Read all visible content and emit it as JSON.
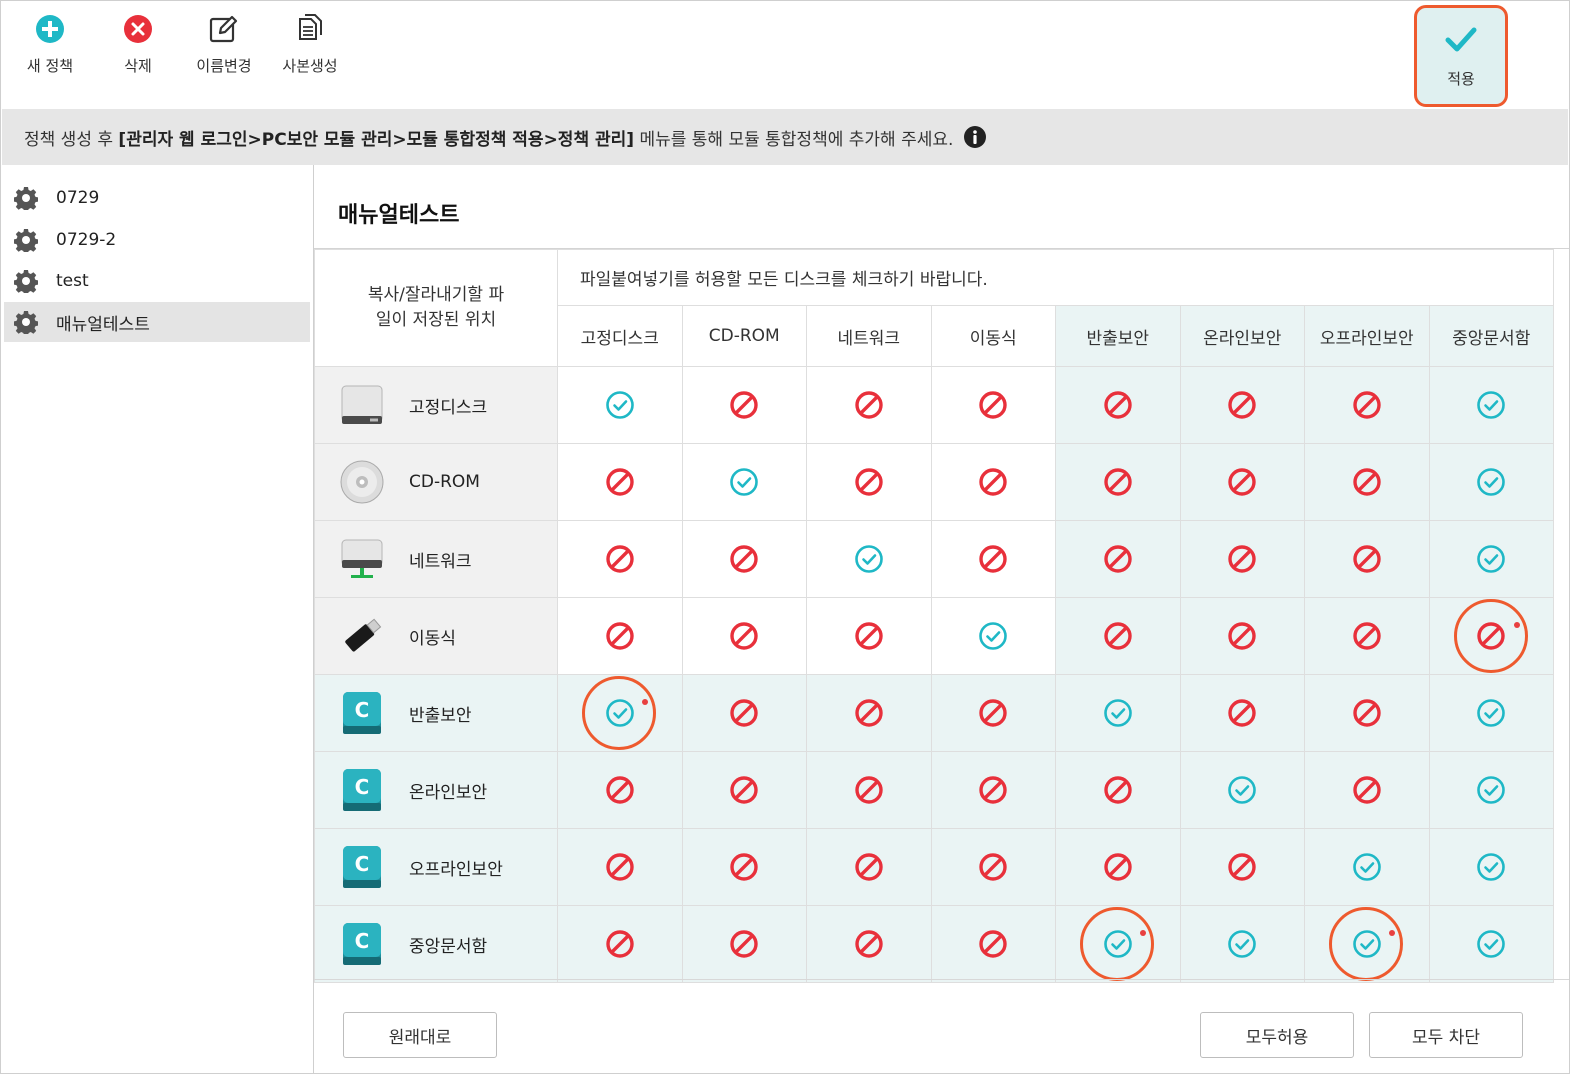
{
  "toolbar": {
    "new_policy": "새 정책",
    "delete": "삭제",
    "rename": "이름변경",
    "copy": "사본생성",
    "apply": "적용"
  },
  "infobar": {
    "prefix": "정책 생성 후 ",
    "path": "[관리자 웹 로그인>PC보안 모듈 관리>모듈 통합정책 적용>정책 관리]",
    "suffix": " 메뉴를 통해 모듈 통합정책에 추가해 주세요."
  },
  "sidebar": {
    "items": [
      {
        "label": "0729"
      },
      {
        "label": "0729-2"
      },
      {
        "label": "test"
      },
      {
        "label": "매뉴얼테스트"
      }
    ]
  },
  "main": {
    "title": "매뉴얼테스트",
    "corner_label_line1": "복사/잘라내기할 파",
    "corner_label_line2": "일이 저장된 위치",
    "instruction": "파일붙여넣기를 허용할 모든 디스크를 체크하기 바랍니다.",
    "columns": [
      "고정디스크",
      "CD-ROM",
      "네트워크",
      "이동식",
      "반출보안",
      "온라인보안",
      "오프라인보안",
      "중앙문서함"
    ],
    "rows": [
      {
        "label": "고정디스크",
        "icon": "hard-disk-icon",
        "values": [
          "allow",
          "block",
          "block",
          "block",
          "block",
          "block",
          "block",
          "allow"
        ]
      },
      {
        "label": "CD-ROM",
        "icon": "cd-rom-icon",
        "values": [
          "block",
          "allow",
          "block",
          "block",
          "block",
          "block",
          "block",
          "allow"
        ]
      },
      {
        "label": "네트워크",
        "icon": "network-drive-icon",
        "values": [
          "block",
          "block",
          "allow",
          "block",
          "block",
          "block",
          "block",
          "allow"
        ]
      },
      {
        "label": "이동식",
        "icon": "usb-drive-icon",
        "values": [
          "block",
          "block",
          "block",
          "allow",
          "block",
          "block",
          "block",
          "block"
        ]
      },
      {
        "label": "반출보안",
        "icon": "secure-drive-icon",
        "values": [
          "allow",
          "block",
          "block",
          "block",
          "allow",
          "block",
          "block",
          "allow"
        ]
      },
      {
        "label": "온라인보안",
        "icon": "secure-drive-icon",
        "values": [
          "block",
          "block",
          "block",
          "block",
          "block",
          "allow",
          "block",
          "allow"
        ]
      },
      {
        "label": "오프라인보안",
        "icon": "secure-drive-icon",
        "values": [
          "block",
          "block",
          "block",
          "block",
          "block",
          "block",
          "allow",
          "allow"
        ]
      },
      {
        "label": "중앙문서함",
        "icon": "secure-drive-icon",
        "values": [
          "block",
          "block",
          "block",
          "block",
          "allow",
          "allow",
          "allow",
          "allow"
        ]
      }
    ],
    "changed_cells": [
      {
        "row": 3,
        "col": 7
      },
      {
        "row": 4,
        "col": 0
      },
      {
        "row": 7,
        "col": 4
      },
      {
        "row": 7,
        "col": 6
      }
    ]
  },
  "buttons": {
    "reset": "원래대로",
    "allow_all": "모두허용",
    "block_all": "모두 차단"
  },
  "colors": {
    "allow": "#1fb8c6",
    "block": "#e8303b",
    "highlight": "#ee5a2e",
    "secure_tint": "#eaf4f4"
  }
}
